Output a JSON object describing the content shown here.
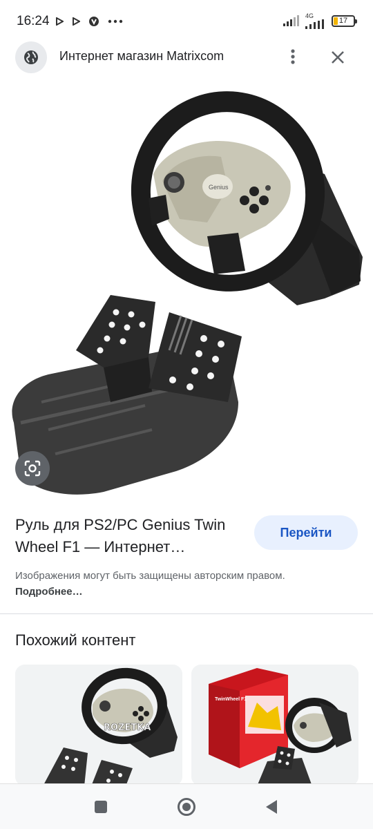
{
  "status_bar": {
    "time": "16:24",
    "network": "4G",
    "battery_level": "17",
    "accent": "#f2b400"
  },
  "header": {
    "title": "Интернет магазин Matrixcom",
    "icons": [
      "globe-icon",
      "more-vert-icon",
      "close-icon"
    ]
  },
  "result": {
    "title": "Руль для PS2/PC Genius Twin Wheel F1 — Интернет…",
    "go_button": "Перейти",
    "copyright_text": "Изображения могут быть защищены авторским правом.",
    "more_link": "Подробнее…"
  },
  "related": {
    "heading": "Похожий контент",
    "cards": [
      {
        "watermark": "ROZETKA"
      },
      {
        "box_label": "TwinWheel F1"
      }
    ]
  },
  "colors": {
    "accent_blue": "#1a56c4",
    "button_bg": "#e8f0fe",
    "text_primary": "#202124",
    "text_secondary": "#5f6368"
  }
}
